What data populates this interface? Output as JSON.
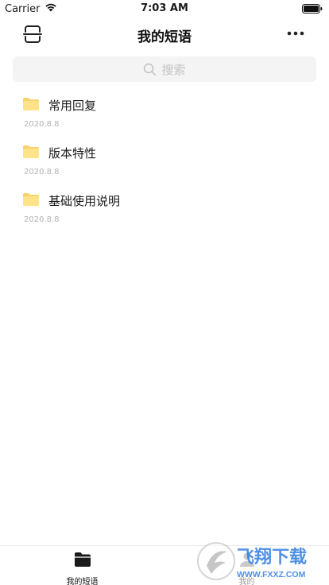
{
  "status_bar": {
    "carrier": "Carrier",
    "time": "7:03 AM"
  },
  "nav": {
    "title": "我的短语",
    "left_icon": "scan-icon",
    "right_icon": "more-icon"
  },
  "search": {
    "placeholder": "搜索"
  },
  "items": [
    {
      "title": "常用回复",
      "date": "2020.8.8"
    },
    {
      "title": "版本特性",
      "date": "2020.8.8"
    },
    {
      "title": "基础使用说明",
      "date": "2020.8.8"
    }
  ],
  "tabs": [
    {
      "label": "我的短语",
      "icon": "folder-icon",
      "active": true
    },
    {
      "label": "我的",
      "icon": "person-icon",
      "active": false
    }
  ],
  "watermark": {
    "text": "飞翔下载",
    "url": "WWW.FXXZ.COM"
  },
  "colors": {
    "folder": "#FFE38A",
    "folder_tab": "#F7D46B",
    "watermark_blue": "#2E7DE1"
  }
}
